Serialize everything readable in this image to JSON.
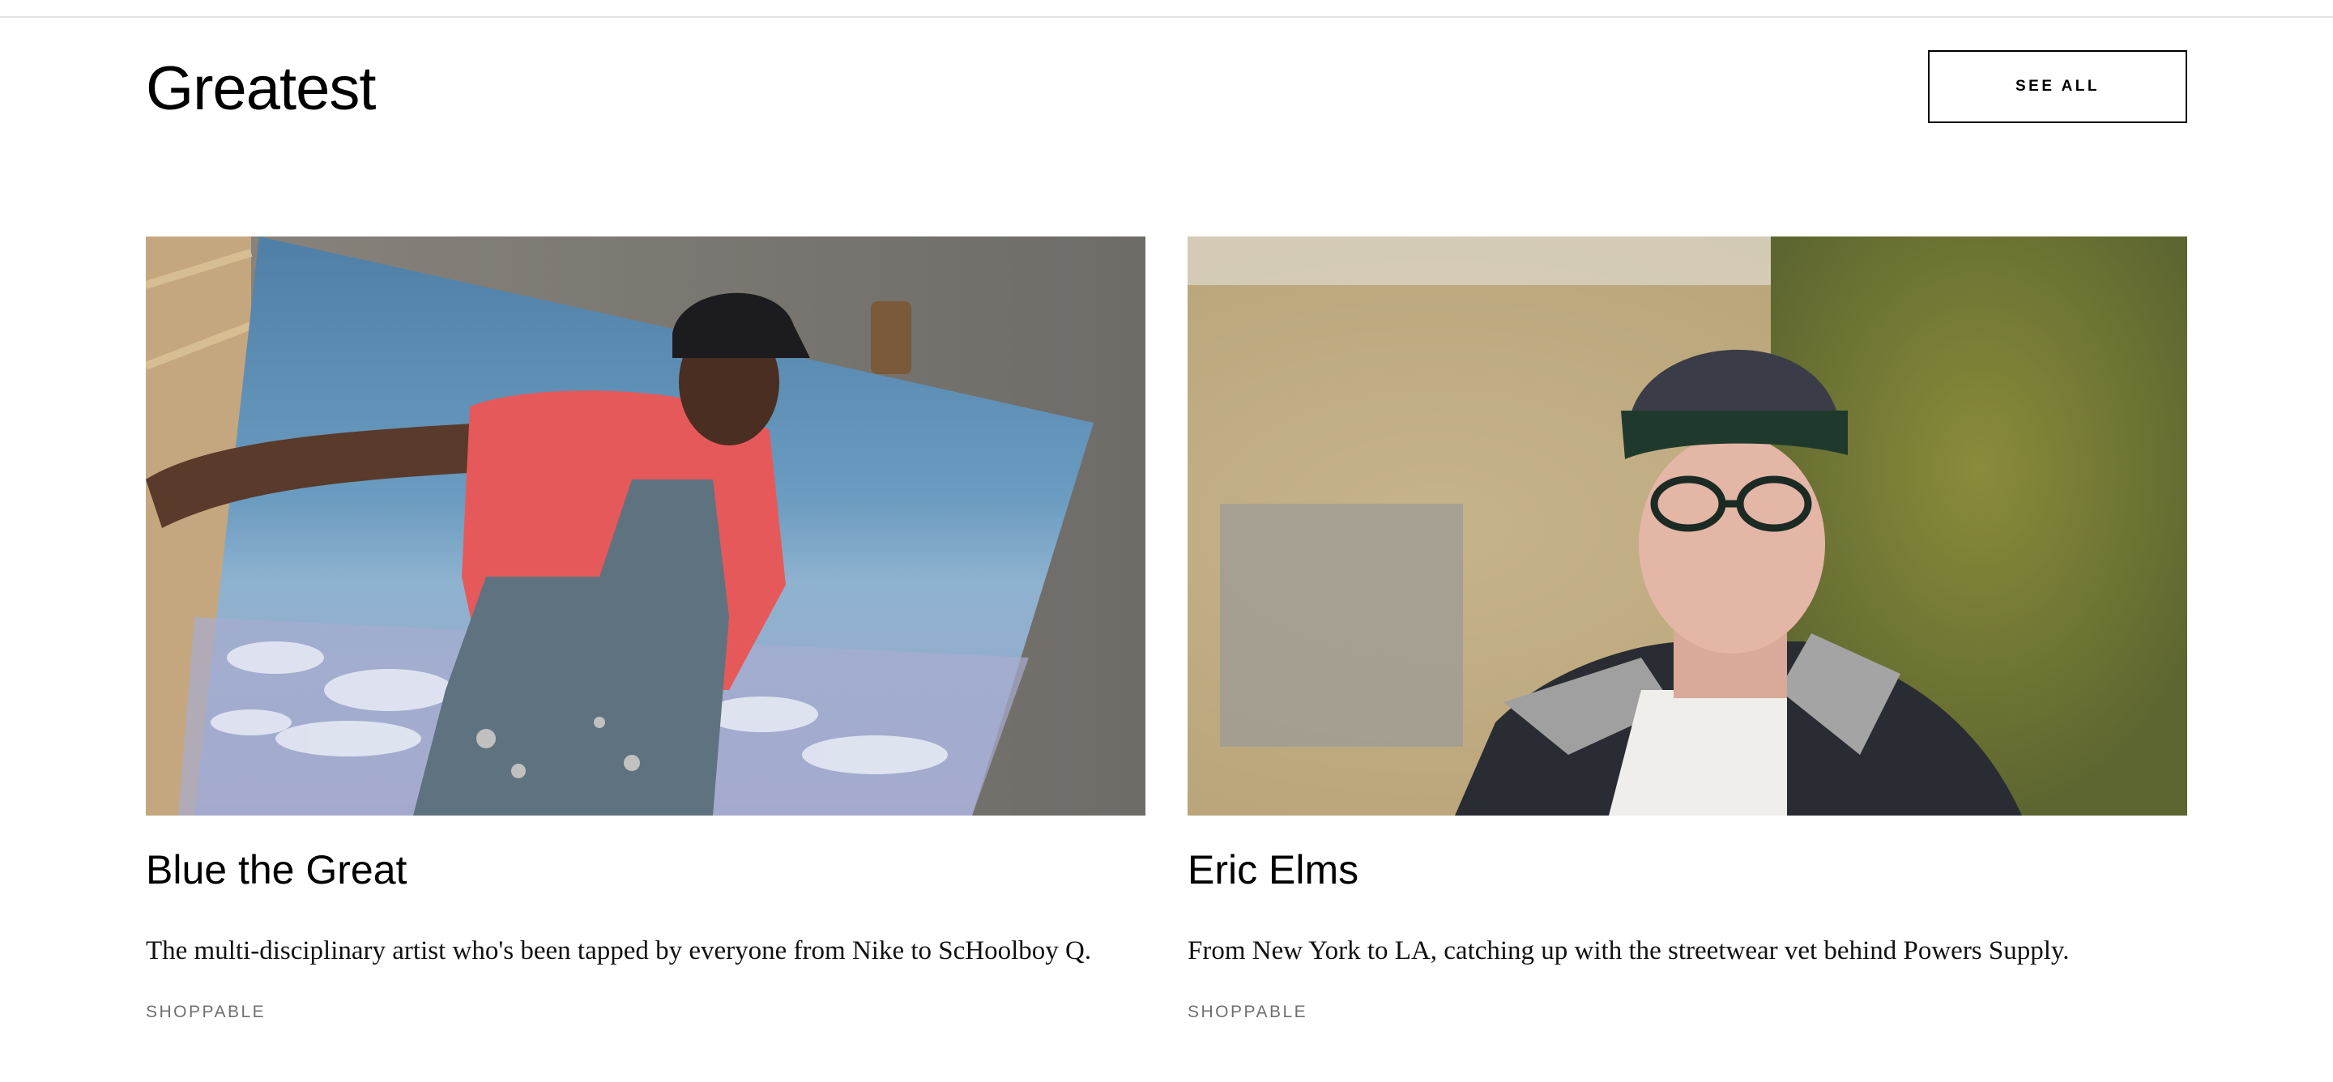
{
  "section": {
    "title": "Greatest",
    "see_all_label": "SEE ALL"
  },
  "cards": [
    {
      "title": "Blue the Great",
      "description": "The multi-disciplinary artist who's been tapped by everyone from Nike to ScHoolboy Q.",
      "tag": "SHOPPABLE",
      "image_icon": "artist-portrait-photo"
    },
    {
      "title": "Eric Elms",
      "description": "From New York to LA, catching up with the streetwear vet behind Powers Supply.",
      "tag": "SHOPPABLE",
      "image_icon": "man-in-cap-portrait-photo"
    }
  ]
}
